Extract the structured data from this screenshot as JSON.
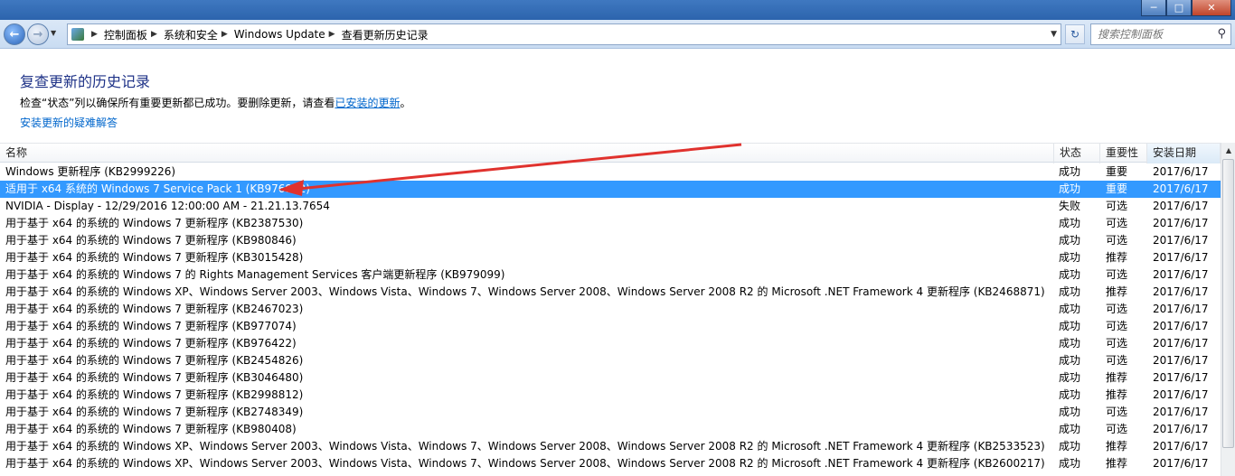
{
  "window": {
    "minimize_icon": "minimize-icon",
    "maximize_icon": "maximize-icon",
    "close_icon": "close-icon"
  },
  "nav": {
    "breadcrumb": [
      "控制面板",
      "系统和安全",
      "Windows Update",
      "查看更新历史记录"
    ],
    "search_placeholder": "搜索控制面板"
  },
  "header": {
    "title": "复查更新的历史记录",
    "desc_prefix": "检查“状态”列以确保所有重要更新都已成功。要删除更新，请查看",
    "desc_link": "已安装的更新",
    "desc_suffix": "。",
    "help_link": "安装更新的疑难解答"
  },
  "columns": {
    "name": "名称",
    "status": "状态",
    "importance": "重要性",
    "date": "安装日期"
  },
  "rows": [
    {
      "name": "Windows 更新程序 (KB2999226)",
      "status": "成功",
      "importance": "重要",
      "date": "2017/6/17"
    },
    {
      "name": "适用于 x64 系统的 Windows 7 Service Pack 1 (KB976932)",
      "status": "成功",
      "importance": "重要",
      "date": "2017/6/17"
    },
    {
      "name": "NVIDIA - Display - 12/29/2016 12:00:00 AM - 21.21.13.7654",
      "status": "失败",
      "importance": "可选",
      "date": "2017/6/17"
    },
    {
      "name": "用于基于 x64 的系统的 Windows 7 更新程序 (KB2387530)",
      "status": "成功",
      "importance": "可选",
      "date": "2017/6/17"
    },
    {
      "name": "用于基于 x64 的系统的 Windows 7 更新程序 (KB980846)",
      "status": "成功",
      "importance": "可选",
      "date": "2017/6/17"
    },
    {
      "name": "用于基于 x64 的系统的 Windows 7 更新程序 (KB3015428)",
      "status": "成功",
      "importance": "推荐",
      "date": "2017/6/17"
    },
    {
      "name": "用于基于 x64 的系统的 Windows 7 的 Rights Management Services 客户端更新程序 (KB979099)",
      "status": "成功",
      "importance": "可选",
      "date": "2017/6/17"
    },
    {
      "name": "用于基于 x64 的系统的 Windows XP、Windows Server 2003、Windows Vista、Windows 7、Windows Server 2008、Windows Server 2008 R2 的 Microsoft .NET Framework 4 更新程序 (KB2468871)",
      "status": "成功",
      "importance": "推荐",
      "date": "2017/6/17"
    },
    {
      "name": "用于基于 x64 的系统的 Windows 7 更新程序 (KB2467023)",
      "status": "成功",
      "importance": "可选",
      "date": "2017/6/17"
    },
    {
      "name": "用于基于 x64 的系统的 Windows 7 更新程序 (KB977074)",
      "status": "成功",
      "importance": "可选",
      "date": "2017/6/17"
    },
    {
      "name": "用于基于 x64 的系统的 Windows 7 更新程序 (KB976422)",
      "status": "成功",
      "importance": "可选",
      "date": "2017/6/17"
    },
    {
      "name": "用于基于 x64 的系统的 Windows 7 更新程序 (KB2454826)",
      "status": "成功",
      "importance": "可选",
      "date": "2017/6/17"
    },
    {
      "name": "用于基于 x64 的系统的 Windows 7 更新程序 (KB3046480)",
      "status": "成功",
      "importance": "推荐",
      "date": "2017/6/17"
    },
    {
      "name": "用于基于 x64 的系统的 Windows 7 更新程序 (KB2998812)",
      "status": "成功",
      "importance": "推荐",
      "date": "2017/6/17"
    },
    {
      "name": "用于基于 x64 的系统的 Windows 7 更新程序 (KB2748349)",
      "status": "成功",
      "importance": "可选",
      "date": "2017/6/17"
    },
    {
      "name": "用于基于 x64 的系统的 Windows 7 更新程序 (KB980408)",
      "status": "成功",
      "importance": "可选",
      "date": "2017/6/17"
    },
    {
      "name": "用于基于 x64 的系统的 Windows XP、Windows Server 2003、Windows Vista、Windows 7、Windows Server 2008、Windows Server 2008 R2 的 Microsoft .NET Framework 4 更新程序 (KB2533523)",
      "status": "成功",
      "importance": "推荐",
      "date": "2017/6/17"
    },
    {
      "name": "用于基于 x64 的系统的 Windows XP、Windows Server 2003、Windows Vista、Windows 7、Windows Server 2008、Windows Server 2008 R2 的 Microsoft .NET Framework 4 更新程序 (KB2600217)",
      "status": "成功",
      "importance": "推荐",
      "date": "2017/6/17"
    }
  ],
  "selected_row": 1,
  "colors": {
    "selection": "#3399ff",
    "title": "#1e3287",
    "link": "#0066cc",
    "annotation_arrow": "#e0322e"
  }
}
